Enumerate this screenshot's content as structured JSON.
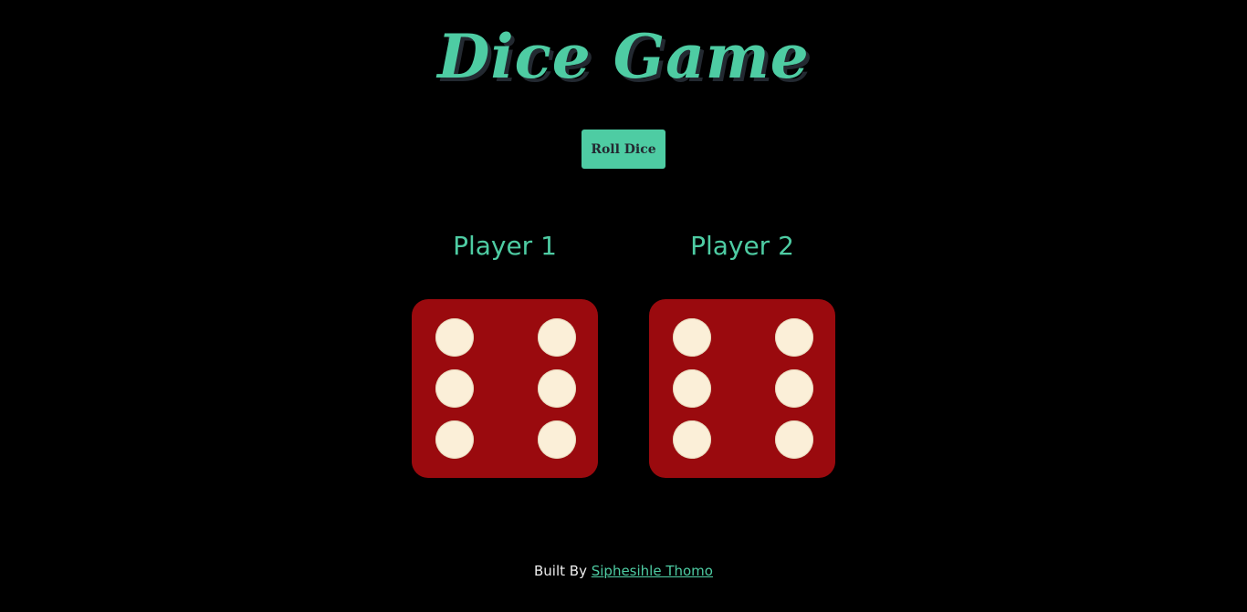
{
  "header": {
    "title": "Dice Game"
  },
  "controls": {
    "roll_button_label": "Roll Dice"
  },
  "players": [
    {
      "name": "Player 1",
      "die_value": 6
    },
    {
      "name": "Player 2",
      "die_value": 6
    }
  ],
  "footer": {
    "prefix": "Built By",
    "author_link_text": "Siphesihle Thomo"
  },
  "colors": {
    "accent": "#4ECCA3",
    "die_face": "#9A0A0E",
    "pip": "#FBEFD8",
    "background": "#000000"
  }
}
